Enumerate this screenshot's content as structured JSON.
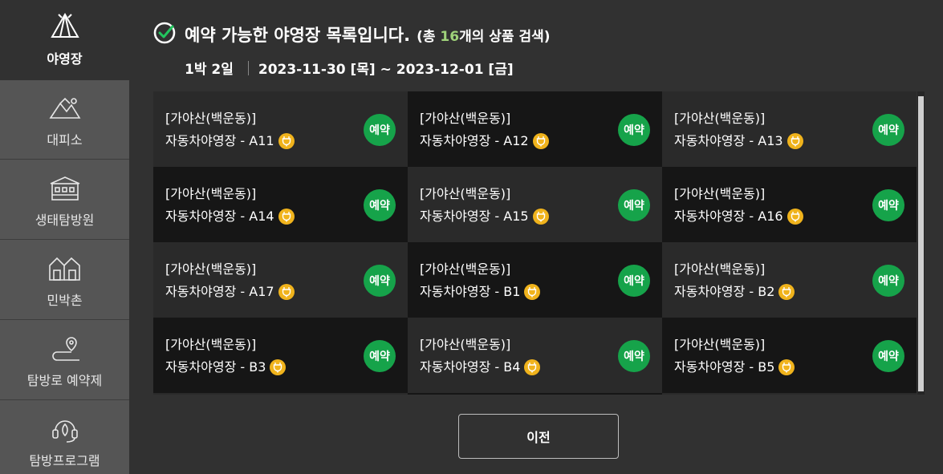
{
  "sidebar": {
    "items": [
      {
        "label": "야영장",
        "icon": "tent-icon",
        "active": true
      },
      {
        "label": "대피소",
        "icon": "mountain-icon",
        "active": false
      },
      {
        "label": "생태탐방원",
        "icon": "building-icon",
        "active": false
      },
      {
        "label": "민박촌",
        "icon": "houses-icon",
        "active": false
      },
      {
        "label": "탐방로 예약제",
        "icon": "trail-icon",
        "active": false
      },
      {
        "label": "탐방프로그램",
        "icon": "headset-icon",
        "active": false
      }
    ]
  },
  "header": {
    "title": "예약 가능한 야영장 목록입니다.",
    "count_prefix": "(총 ",
    "count_num": "16",
    "count_suffix": "개의 상품 검색)",
    "stay": "1박 2일",
    "date_range": "2023-11-30 [목] ~ 2023-12-01 [금]"
  },
  "sites": [
    {
      "area": "[가야산(백운동)]",
      "name": "자동차야영장 - A11"
    },
    {
      "area": "[가야산(백운동)]",
      "name": "자동차야영장 - A12"
    },
    {
      "area": "[가야산(백운동)]",
      "name": "자동차야영장 - A13"
    },
    {
      "area": "[가야산(백운동)]",
      "name": "자동차야영장 - A14"
    },
    {
      "area": "[가야산(백운동)]",
      "name": "자동차야영장 - A15"
    },
    {
      "area": "[가야산(백운동)]",
      "name": "자동차야영장 - A16"
    },
    {
      "area": "[가야산(백운동)]",
      "name": "자동차야영장 - A17"
    },
    {
      "area": "[가야산(백운동)]",
      "name": "자동차야영장 - B1"
    },
    {
      "area": "[가야산(백운동)]",
      "name": "자동차야영장 - B2"
    },
    {
      "area": "[가야산(백운동)]",
      "name": "자동차야영장 - B3"
    },
    {
      "area": "[가야산(백운동)]",
      "name": "자동차야영장 - B4"
    },
    {
      "area": "[가야산(백운동)]",
      "name": "자동차야영장 - B5"
    }
  ],
  "reserve_label": "예약",
  "prev_label": "이전",
  "colors": {
    "reserve_badge": "#16a34a",
    "count_highlight": "#9fd27a",
    "plug_badge": "#f0b31c"
  }
}
